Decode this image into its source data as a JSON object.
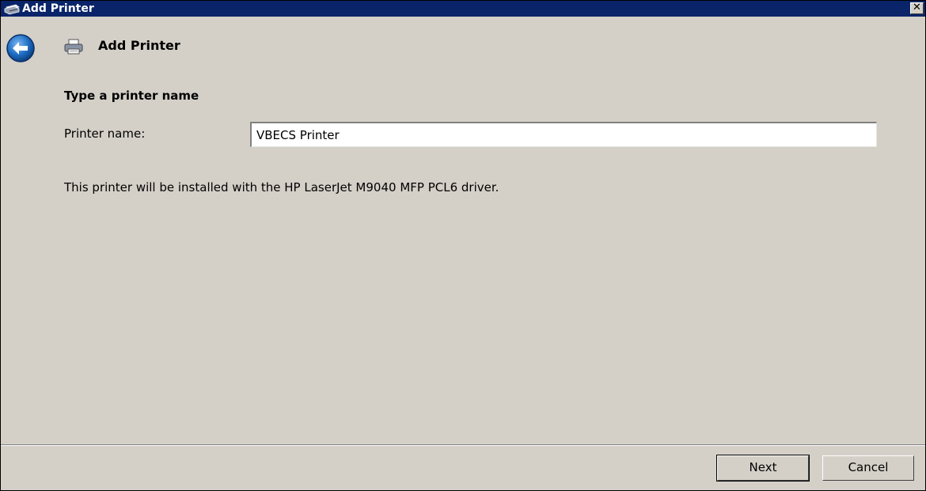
{
  "window": {
    "title": "Add Printer",
    "close_label": "✕"
  },
  "header": {
    "title": "Add Printer",
    "back_icon": "back-arrow-icon",
    "printer_icon": "printer-icon"
  },
  "main": {
    "heading": "Type a printer name",
    "printer_name_label": "Printer name:",
    "printer_name_value": "VBECS Printer",
    "info_text": "This printer will be installed with the HP LaserJet M9040 MFP PCL6 driver."
  },
  "footer": {
    "next_label": "Next",
    "cancel_label": "Cancel"
  },
  "colors": {
    "titlebar": "#0a246a",
    "background": "#d4d0c8",
    "back_button": "#1f6fc5"
  }
}
